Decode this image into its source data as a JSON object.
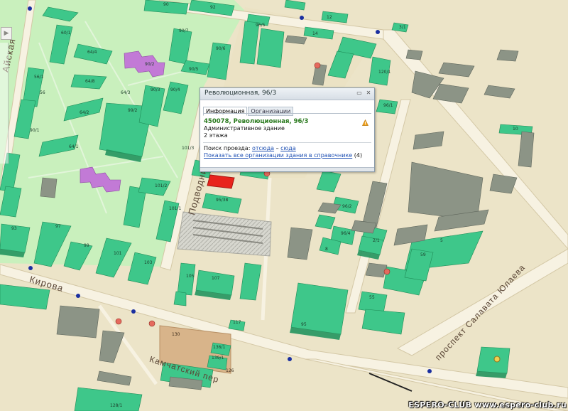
{
  "streets": {
    "aiskaya": "Айская",
    "podvodnika": "Подводника",
    "kirova": "Кирова",
    "yulaeva": "проспект Салавата Юлаева",
    "kamchatsky": "Камчатский пер"
  },
  "popup": {
    "title": "Революционная, 96/3",
    "tabs": [
      "Информация",
      "Организации"
    ],
    "active_tab": "Информация",
    "address": "450078, Революционная, 96/3",
    "building_type": "Административное здание",
    "floors": "2 этажа",
    "route_label": "Поиск проезда:",
    "route_from": "отсюда",
    "route_dash": "–",
    "route_to": "сюда",
    "show_orgs_link": "Показать все организации здания в справочнике",
    "orgs_count": "(4)",
    "warning_icon": "warning-icon"
  },
  "nav": {
    "arrow_glyph": "▶"
  },
  "building_numbers": [
    "90",
    "92",
    "12",
    "14",
    "60/1",
    "64/4",
    "90/2",
    "90/5",
    "90/6",
    "56/1",
    "56",
    "64/3",
    "64/8",
    "90/3",
    "90/4",
    "90/7",
    "93",
    "64/2",
    "99/2",
    "101/3",
    "64/1",
    "90/1",
    "101/2",
    "101/1",
    "95/38",
    "93",
    "97",
    "99",
    "101",
    "103",
    "105",
    "107",
    "117",
    "130",
    "136/1",
    "139/1",
    "128/1",
    "126",
    "96/5",
    "3/1",
    "120/1",
    "96/1",
    "10",
    "2/1",
    "5",
    "59",
    "55",
    "8",
    "96/2",
    "96/4",
    "3/2",
    "95"
  ],
  "watermark": "ESPERO-CLUB  www.espero-club.ru",
  "colors": {
    "park": "#c9f0bd",
    "residential": "#a6eba0",
    "ground": "#ece4c8",
    "road": "#f7f2e2",
    "building_green": "#3ec78a",
    "building_gray": "#8c9486",
    "highlight": "#e8231c",
    "link": "#1d4fb3",
    "address_green": "#2a7a1e"
  }
}
